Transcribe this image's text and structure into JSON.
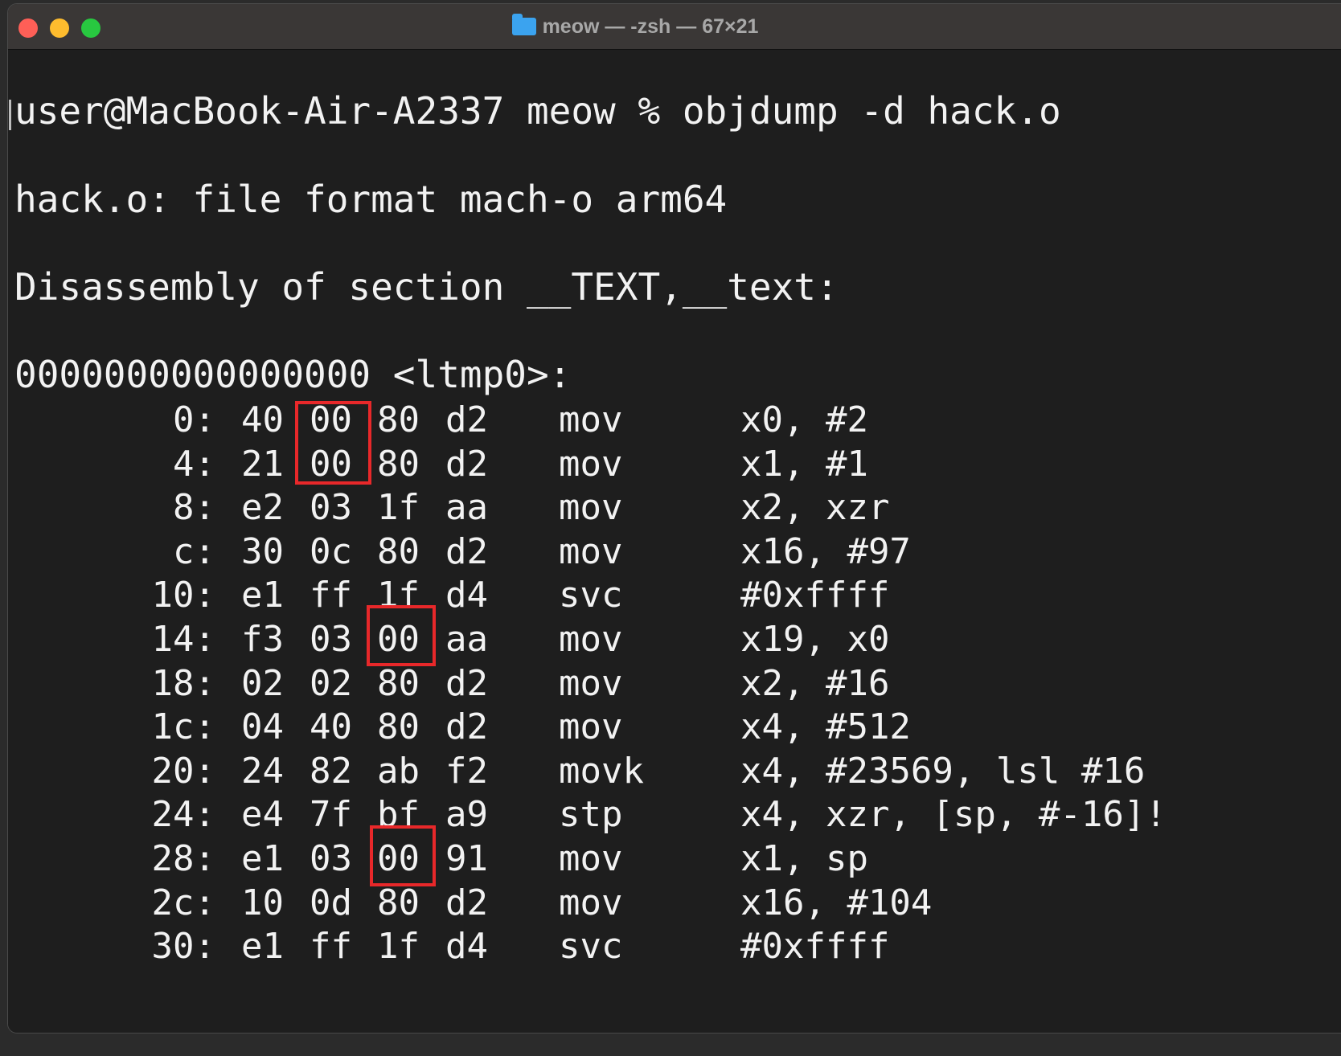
{
  "window": {
    "title": "meow — -zsh — 67×21",
    "folder_icon": "folder-icon"
  },
  "terminal": {
    "prompt_line": "user@MacBook-Air-A2337 meow % objdump -d hack.o",
    "file_format_line": "hack.o: file format mach-o arm64",
    "section_line": "Disassembly of section __TEXT,__text:",
    "symbol_line": "0000000000000000 <ltmp0>:",
    "rows": [
      {
        "addr": "0:",
        "b1": "40",
        "b2": "00",
        "b3": "80",
        "b4": "d2",
        "op": "mov",
        "args": "x0, #2"
      },
      {
        "addr": "4:",
        "b1": "21",
        "b2": "00",
        "b3": "80",
        "b4": "d2",
        "op": "mov",
        "args": "x1, #1"
      },
      {
        "addr": "8:",
        "b1": "e2",
        "b2": "03",
        "b3": "1f",
        "b4": "aa",
        "op": "mov",
        "args": "x2, xzr"
      },
      {
        "addr": "c:",
        "b1": "30",
        "b2": "0c",
        "b3": "80",
        "b4": "d2",
        "op": "mov",
        "args": "x16, #97"
      },
      {
        "addr": "10:",
        "b1": "e1",
        "b2": "ff",
        "b3": "1f",
        "b4": "d4",
        "op": "svc",
        "args": "#0xffff"
      },
      {
        "addr": "14:",
        "b1": "f3",
        "b2": "03",
        "b3": "00",
        "b4": "aa",
        "op": "mov",
        "args": "x19, x0"
      },
      {
        "addr": "18:",
        "b1": "02",
        "b2": "02",
        "b3": "80",
        "b4": "d2",
        "op": "mov",
        "args": "x2, #16"
      },
      {
        "addr": "1c:",
        "b1": "04",
        "b2": "40",
        "b3": "80",
        "b4": "d2",
        "op": "mov",
        "args": "x4, #512"
      },
      {
        "addr": "20:",
        "b1": "24",
        "b2": "82",
        "b3": "ab",
        "b4": "f2",
        "op": "movk",
        "args": "x4, #23569, lsl #16"
      },
      {
        "addr": "24:",
        "b1": "e4",
        "b2": "7f",
        "b3": "bf",
        "b4": "a9",
        "op": "stp",
        "args": "x4, xzr, [sp, #-16]!"
      },
      {
        "addr": "28:",
        "b1": "e1",
        "b2": "03",
        "b3": "00",
        "b4": "91",
        "op": "mov",
        "args": "x1, sp"
      },
      {
        "addr": "2c:",
        "b1": "10",
        "b2": "0d",
        "b3": "80",
        "b4": "d2",
        "op": "mov",
        "args": "x16, #104"
      },
      {
        "addr": "30:",
        "b1": "e1",
        "b2": "ff",
        "b3": "1f",
        "b4": "d4",
        "op": "svc",
        "args": "#0xffff"
      }
    ]
  },
  "colors": {
    "background": "#1e1e1e",
    "text": "#f2f2f2",
    "highlight": "#e8282a"
  }
}
